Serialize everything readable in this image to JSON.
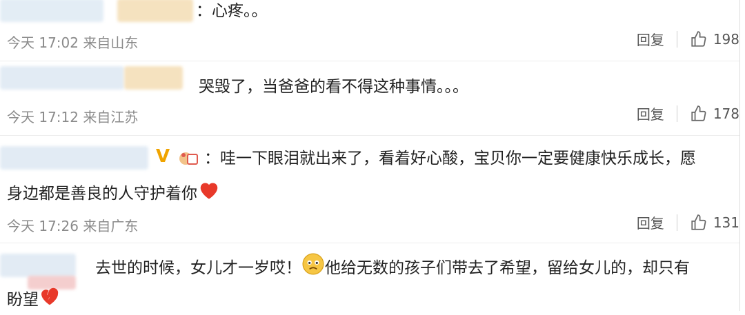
{
  "comments": [
    {
      "text": "：心疼。。",
      "time": "今天 17:02 来自山东",
      "reply": "回复",
      "likes": "198"
    },
    {
      "text": "哭毁了，当爸爸的看不得这种事情。。。",
      "time": "今天 17:12 来自江苏",
      "reply": "回复",
      "likes": "178"
    },
    {
      "text_line1": "：哇一下眼泪就出来了，看着好心酸，宝贝你一定要健康快乐成长，愿",
      "text_line2": "身边都是善良的人守护着你",
      "time": "今天 17:26 来自广东",
      "reply": "回复",
      "likes": "131",
      "badge": "V"
    },
    {
      "text_line1a": "去世的时候，女儿才一岁哎！",
      "text_line1b": "他给无数的孩子们带去了希望，留给女儿的，却只有",
      "text_line2": "盼望"
    }
  ],
  "icons": {
    "like": "thumbs-up-icon",
    "heart": "red-heart-icon",
    "broken_heart": "broken-heart-icon",
    "sad_face": "sad-face-emoji"
  }
}
